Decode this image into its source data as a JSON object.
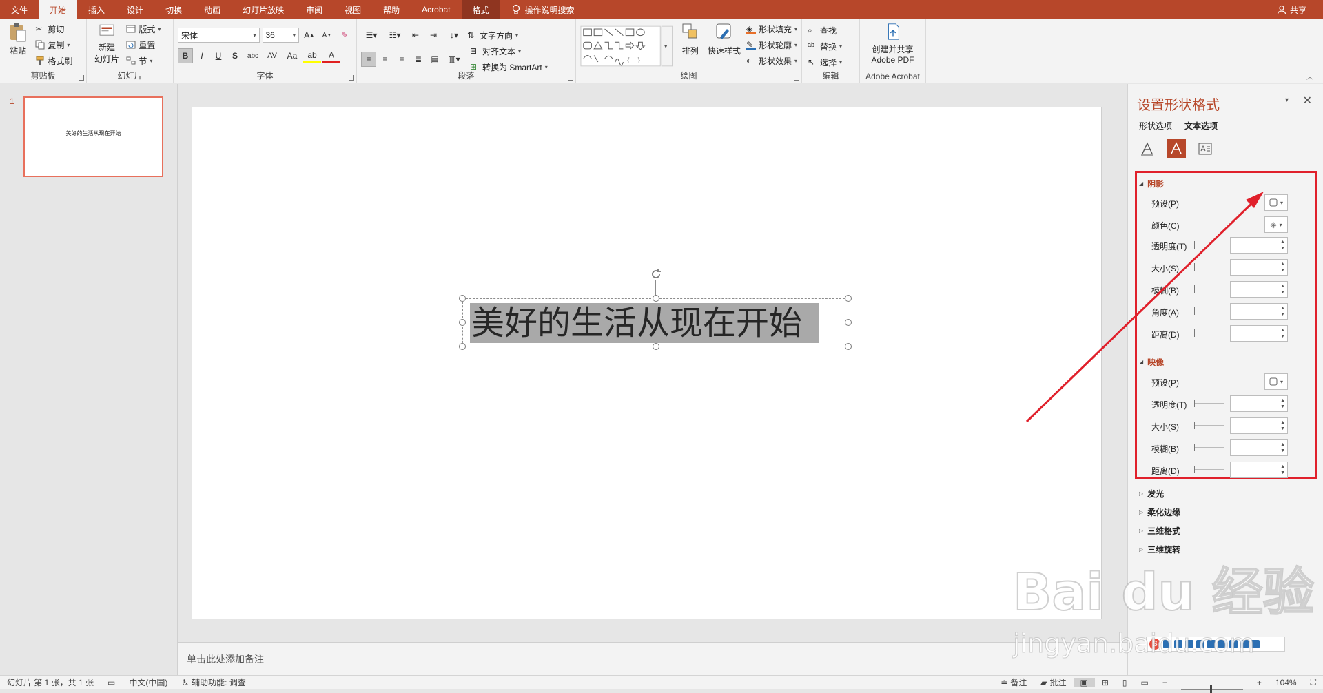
{
  "tabs": [
    {
      "label": "文件",
      "active": false
    },
    {
      "label": "开始",
      "active": true
    },
    {
      "label": "插入",
      "active": false
    },
    {
      "label": "设计",
      "active": false
    },
    {
      "label": "切换",
      "active": false
    },
    {
      "label": "动画",
      "active": false
    },
    {
      "label": "幻灯片放映",
      "active": false
    },
    {
      "label": "审阅",
      "active": false
    },
    {
      "label": "视图",
      "active": false
    },
    {
      "label": "帮助",
      "active": false
    },
    {
      "label": "Acrobat",
      "active": false
    },
    {
      "label": "格式",
      "active": false,
      "contextual": true
    }
  ],
  "tell_me": "操作说明搜索",
  "share": "共享",
  "ribbon": {
    "clipboard": {
      "paste": "粘贴",
      "cut": "剪切",
      "copy": "复制",
      "format_painter": "格式刷",
      "label": "剪贴板"
    },
    "slides": {
      "new_slide_1": "新建",
      "new_slide_2": "幻灯片",
      "layout": "版式",
      "reset": "重置",
      "section": "节",
      "label": "幻灯片"
    },
    "font": {
      "font_name": "宋体",
      "font_size": "36",
      "bold": "B",
      "italic": "I",
      "underline": "U",
      "shadow": "S",
      "strike": "abc",
      "spacing": "AV",
      "case": "Aa",
      "label": "字体"
    },
    "paragraph": {
      "text_direction": "文字方向",
      "align_text": "对齐文本",
      "smartart": "转换为 SmartArt",
      "label": "段落"
    },
    "drawing": {
      "arrange": "排列",
      "quick_styles": "快速样式",
      "shape_fill": "形状填充",
      "shape_outline": "形状轮廓",
      "shape_effects": "形状效果",
      "label": "绘图"
    },
    "editing": {
      "find": "查找",
      "replace": "替换",
      "select": "选择",
      "label": "编辑"
    },
    "acrobat": {
      "create_1": "创建并共享",
      "create_2": "Adobe PDF",
      "label": "Adobe Acrobat"
    }
  },
  "thumbnail": {
    "number": "1",
    "text": "美好的生活从现在开始"
  },
  "slide": {
    "text": "美好的生活从现在开始"
  },
  "notes_placeholder": "单击此处添加备注",
  "format_pane": {
    "title": "设置形状格式",
    "tabs": [
      "形状选项",
      "文本选项"
    ],
    "shadow": {
      "header": "阴影",
      "rows": [
        "预设(P)",
        "颜色(C)",
        "透明度(T)",
        "大小(S)",
        "模糊(B)",
        "角度(A)",
        "距离(D)"
      ]
    },
    "reflection": {
      "header": "映像",
      "rows": [
        "预设(P)",
        "透明度(T)",
        "大小(S)",
        "模糊(B)",
        "距离(D)"
      ]
    },
    "collapsed": [
      "发光",
      "柔化边缘",
      "三维格式",
      "三维旋转"
    ]
  },
  "status": {
    "slide_info": "幻灯片 第 1 张，共 1 张",
    "language": "中文(中国)",
    "accessibility": "辅助功能: 调查",
    "notes": "备注",
    "comments": "批注",
    "zoom": "104%"
  },
  "watermark": {
    "logo": "Bai du 经验",
    "url": "jingyan.baidu.com"
  },
  "colors": {
    "accent": "#b7472a",
    "annotation": "#e0202b",
    "selection": "#a9a9a9"
  }
}
